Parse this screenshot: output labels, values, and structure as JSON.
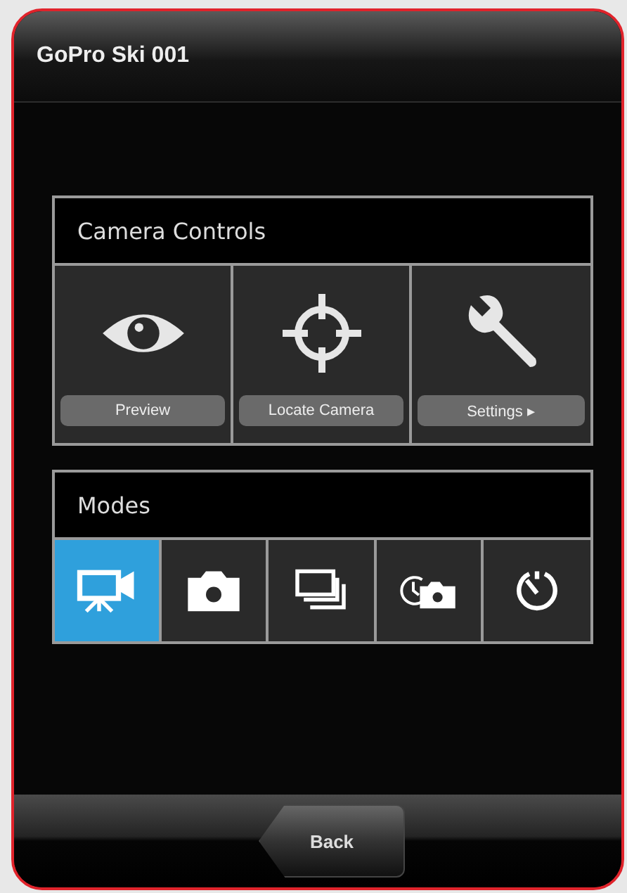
{
  "header": {
    "title": "GoPro Ski 001"
  },
  "camera_controls": {
    "title": "Camera Controls",
    "items": [
      {
        "kind": "eye",
        "label": "Preview"
      },
      {
        "kind": "crosshair",
        "label": "Locate Camera"
      },
      {
        "kind": "wrench",
        "label": "Settings ▸"
      }
    ]
  },
  "modes": {
    "title": "Modes",
    "items": [
      {
        "kind": "video",
        "selected": true
      },
      {
        "kind": "photo",
        "selected": false
      },
      {
        "kind": "burst",
        "selected": false
      },
      {
        "kind": "timelapse",
        "selected": false
      },
      {
        "kind": "timer",
        "selected": false
      }
    ]
  },
  "footer": {
    "back": "Back"
  }
}
